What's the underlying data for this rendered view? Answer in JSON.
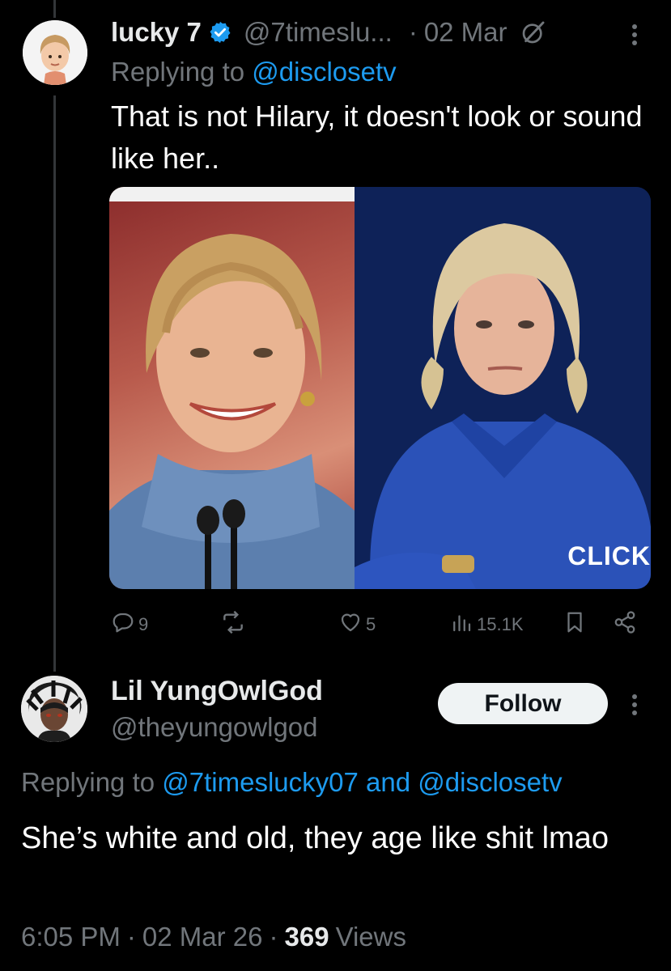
{
  "tweet1": {
    "name": "lucky 7",
    "handle": "@7timeslu...",
    "dot": "·",
    "date": "02 Mar",
    "replying_prefix": "Replying to",
    "replying_mention": "@disclosetv",
    "text": "That is not Hilary, it doesn't look or sound like her..",
    "media_overlay_text": "CLICK",
    "stats": {
      "replies": "9",
      "likes": "5",
      "views": "15.1K"
    }
  },
  "tweet2": {
    "name": "Lil YungOwlGod",
    "handle": "@theyungowlgod",
    "follow_label": "Follow",
    "replying_prefix": "Replying to",
    "replying_mention_1": "@7timeslucky07",
    "replying_and": "and",
    "replying_mention_2": "@disclosetv",
    "text": "She’s white and old, they age like shit lmao",
    "time": "6:05 PM",
    "date": "02 Mar 26",
    "views_count": "369",
    "views_label": "Views",
    "sep": "·"
  },
  "colors": {
    "background": "#000000",
    "text_primary": "#e7e9ea",
    "text_muted": "#71767b",
    "link": "#1d9bf0",
    "verified": "#1d9bf0"
  },
  "icons": [
    "grok-icon",
    "more-icon",
    "reply-icon",
    "retweet-icon",
    "like-icon",
    "views-icon",
    "bookmark-icon",
    "share-icon",
    "verified-badge-icon"
  ]
}
